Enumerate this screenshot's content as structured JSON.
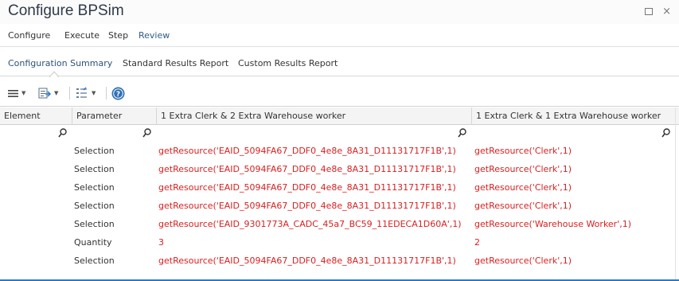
{
  "window": {
    "title": "Configure BPSim"
  },
  "menu": [
    {
      "label": "Configure"
    },
    {
      "label": "Execute"
    },
    {
      "label": "Step"
    },
    {
      "label": "Review"
    }
  ],
  "subtabs": [
    {
      "label": "Configuration Summary"
    },
    {
      "label": "Standard Results Report"
    },
    {
      "label": "Custom Results Report"
    }
  ],
  "toolbar": {
    "icons": [
      "menu-icon",
      "export-icon",
      "columns-icon",
      "help-icon"
    ]
  },
  "table": {
    "columns": [
      {
        "label": "Element"
      },
      {
        "label": "Parameter"
      },
      {
        "label": "1 Extra Clerk & 2 Extra Warehouse worker"
      },
      {
        "label": "1 Extra Clerk & 1 Extra Warehouse worker"
      }
    ],
    "rows": [
      {
        "element": "",
        "parameter": "Selection",
        "v1": "getResource('EAID_5094FA67_DDF0_4e8e_8A31_D11131717F1B',1)",
        "v2": "getResource('Clerk',1)"
      },
      {
        "element": "",
        "parameter": "Selection",
        "v1": "getResource('EAID_5094FA67_DDF0_4e8e_8A31_D11131717F1B',1)",
        "v2": "getResource('Clerk',1)"
      },
      {
        "element": "",
        "parameter": "Selection",
        "v1": "getResource('EAID_5094FA67_DDF0_4e8e_8A31_D11131717F1B',1)",
        "v2": "getResource('Clerk',1)"
      },
      {
        "element": "",
        "parameter": "Selection",
        "v1": "getResource('EAID_5094FA67_DDF0_4e8e_8A31_D11131717F1B',1)",
        "v2": "getResource('Clerk',1)"
      },
      {
        "element": "",
        "parameter": "Selection",
        "v1": "getResource('EAID_9301773A_CADC_45a7_BC59_11EDECA1D60A',1)",
        "v2": "getResource('Warehouse Worker',1)"
      },
      {
        "element": "",
        "parameter": "Quantity",
        "v1": "3",
        "v2": "2"
      },
      {
        "element": "",
        "parameter": "Selection",
        "v1": "getResource('EAID_5094FA67_DDF0_4e8e_8A31_D11131717F1B',1)",
        "v2": "getResource('Clerk',1)"
      }
    ]
  },
  "colors": {
    "value_text": "#d81f1f",
    "accent": "#2f5c86",
    "bottom_bar": "#2c78c8"
  }
}
